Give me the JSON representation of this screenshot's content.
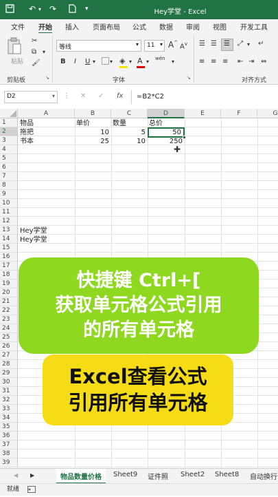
{
  "window": {
    "title": "Hey学堂 - Excel"
  },
  "ribbon_tabs": [
    "文件",
    "开始",
    "插入",
    "页面布局",
    "公式",
    "数据",
    "审阅",
    "视图",
    "开发工具"
  ],
  "ribbon": {
    "paste_label": "粘贴",
    "clipboard_label": "剪贴板",
    "font_label": "字体",
    "align_label": "对齐方式",
    "font_name": "等线",
    "font_size": "11",
    "bold": "B",
    "italic": "I",
    "underline": "U",
    "grow_font": "A",
    "shrink_font": "A",
    "font_color_glyph": "A",
    "wen_glyph": "wén"
  },
  "formula_bar": {
    "name_box": "D2",
    "fx": "fx",
    "cancel": "✕",
    "confirm": "✓",
    "formula": "=B2*C2"
  },
  "grid": {
    "columns": [
      "A",
      "B",
      "C",
      "D",
      "E",
      "F",
      "G"
    ],
    "rows": [
      "1",
      "2",
      "3",
      "4",
      "5",
      "6",
      "7",
      "8",
      "9",
      "10",
      "11",
      "12",
      "13",
      "14",
      "15",
      "16",
      "17",
      "18",
      "19",
      "20",
      "21",
      "22",
      "23",
      "24",
      "25",
      "26",
      "27",
      "28",
      "29",
      "30",
      "31",
      "32",
      "33",
      "34",
      "35",
      "36",
      "37",
      "38",
      "39"
    ],
    "cells": {
      "A1": "物品",
      "B1": "单价",
      "C1": "数量",
      "D1": "总价",
      "A2": "拖把",
      "B2": "10",
      "C2": "5",
      "D2": "50",
      "A3": "书本",
      "B3": "25",
      "C3": "10",
      "D3": "250",
      "A12": "Hey学堂",
      "A13": "Hey学堂"
    }
  },
  "overlay": {
    "banner1_lines": [
      "快捷键 Ctrl+[",
      "获取单元格公式引用",
      "的所有单元格"
    ],
    "banner2_lines": [
      "Excel查看公式",
      "引用所有单元格"
    ]
  },
  "sheet_tabs": [
    "物品数量价格",
    "Sheet9",
    "证件照",
    "Sheet2",
    "Sheet8",
    "自动换行"
  ],
  "status": {
    "text": "就绪"
  },
  "colors": {
    "excel_green": "#217346",
    "banner1": "#8ed81f",
    "banner2": "#f5dc14"
  }
}
